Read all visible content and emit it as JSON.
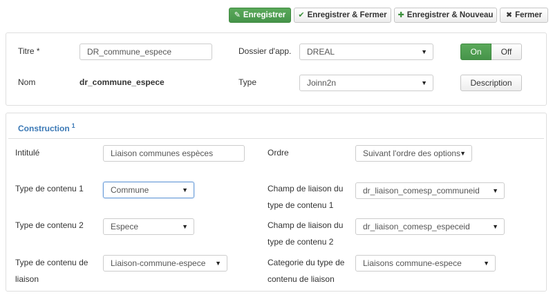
{
  "toolbar": {
    "save_label": "Enregistrer",
    "save_close_label": "Enregistrer & Fermer",
    "save_new_label": "Enregistrer & Nouveau",
    "close_label": "Fermer"
  },
  "general": {
    "title_label": "Titre *",
    "title_value": "DR_commune_espece",
    "name_label": "Nom",
    "name_value": "dr_commune_espece",
    "folder_label": "Dossier d'app.",
    "folder_value": "DREAL",
    "type_label": "Type",
    "type_value": "Joinn2n",
    "toggle_on": "On",
    "toggle_off": "Off",
    "description_label": "Description"
  },
  "construction": {
    "title": "Construction",
    "title_sup": "1",
    "intitule_label": "Intitulé",
    "intitule_value": "Liaison communes espèces",
    "ordre_label": "Ordre",
    "ordre_value": "Suivant l'ordre des options",
    "type1_label": "Type de contenu 1",
    "type1_value": "Commune",
    "champ1_label": "Champ de liaison du type de contenu 1",
    "champ1_value": "dr_liaison_comesp_communeid",
    "type2_label": "Type de contenu 2",
    "type2_value": "Espece",
    "champ2_label": "Champ de liaison du type de contenu 2",
    "champ2_value": "dr_liaison_comesp_especeid",
    "typeliaison_label": "Type de contenu de liaison",
    "typeliaison_value": "Liaison-commune-espece",
    "categorie_label": "Categorie du type de contenu de liaison",
    "categorie_value": "Liaisons commune-espece"
  },
  "colors": {
    "primary_green": "#4a9a4a",
    "link_blue": "#3a78b5"
  }
}
